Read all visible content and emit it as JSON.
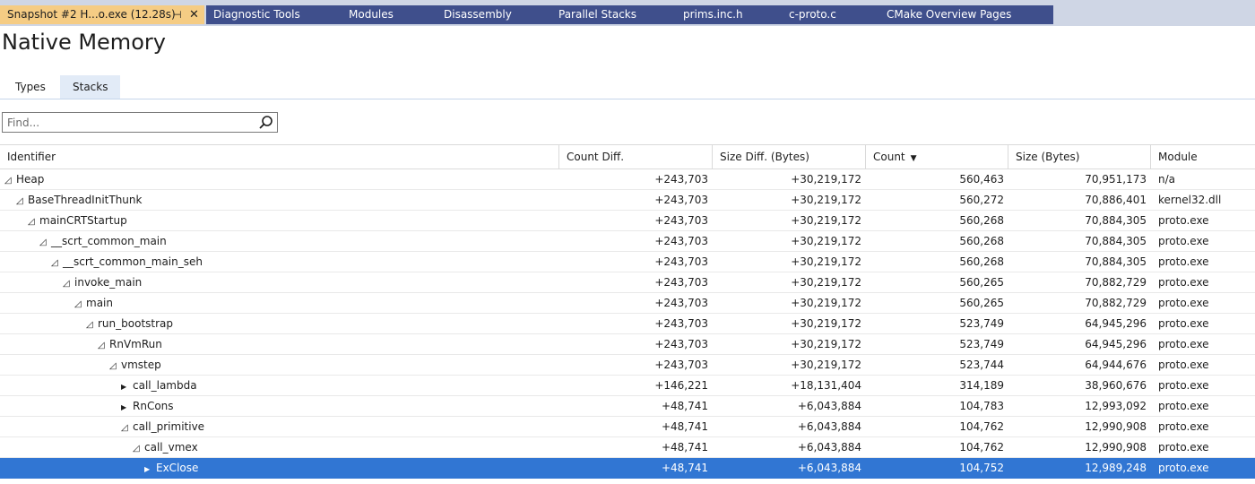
{
  "doc_tabs": [
    {
      "label": "Snapshot #2 H...o.exe (12.28s)",
      "active": true,
      "pin_icon": "pin-icon",
      "close_icon": "close-icon"
    },
    {
      "label": "Diagnostic Tools"
    },
    {
      "label": "Modules"
    },
    {
      "label": "Disassembly"
    },
    {
      "label": "Parallel Stacks"
    },
    {
      "label": "prims.inc.h"
    },
    {
      "label": "c-proto.c"
    },
    {
      "label": "CMake Overview Pages"
    }
  ],
  "page_title": "Native Memory",
  "view_tabs": [
    {
      "label": "Types",
      "selected": false
    },
    {
      "label": "Stacks",
      "selected": true
    }
  ],
  "search": {
    "placeholder": "Find...",
    "value": "",
    "icon": "search-icon"
  },
  "columns": {
    "identifier": "Identifier",
    "count_diff": "Count Diff.",
    "size_diff": "Size Diff. (Bytes)",
    "count": "Count",
    "size": "Size (Bytes)",
    "module": "Module",
    "sort_indicator": "▼"
  },
  "rows": [
    {
      "name": "Heap",
      "depth": 0,
      "expander": "expanded",
      "count_diff": "+243,703",
      "size_diff": "+30,219,172",
      "count": "560,463",
      "size": "70,951,173",
      "module": "n/a"
    },
    {
      "name": "BaseThreadInitThunk",
      "depth": 1,
      "expander": "expanded",
      "count_diff": "+243,703",
      "size_diff": "+30,219,172",
      "count": "560,272",
      "size": "70,886,401",
      "module": "kernel32.dll"
    },
    {
      "name": "mainCRTStartup",
      "depth": 2,
      "expander": "expanded",
      "count_diff": "+243,703",
      "size_diff": "+30,219,172",
      "count": "560,268",
      "size": "70,884,305",
      "module": "proto.exe"
    },
    {
      "name": "__scrt_common_main",
      "depth": 3,
      "expander": "expanded",
      "count_diff": "+243,703",
      "size_diff": "+30,219,172",
      "count": "560,268",
      "size": "70,884,305",
      "module": "proto.exe"
    },
    {
      "name": "__scrt_common_main_seh",
      "depth": 4,
      "expander": "expanded",
      "count_diff": "+243,703",
      "size_diff": "+30,219,172",
      "count": "560,268",
      "size": "70,884,305",
      "module": "proto.exe"
    },
    {
      "name": "invoke_main",
      "depth": 5,
      "expander": "expanded",
      "count_diff": "+243,703",
      "size_diff": "+30,219,172",
      "count": "560,265",
      "size": "70,882,729",
      "module": "proto.exe"
    },
    {
      "name": "main",
      "depth": 6,
      "expander": "expanded",
      "count_diff": "+243,703",
      "size_diff": "+30,219,172",
      "count": "560,265",
      "size": "70,882,729",
      "module": "proto.exe"
    },
    {
      "name": "run_bootstrap",
      "depth": 7,
      "expander": "expanded",
      "count_diff": "+243,703",
      "size_diff": "+30,219,172",
      "count": "523,749",
      "size": "64,945,296",
      "module": "proto.exe"
    },
    {
      "name": "RnVmRun",
      "depth": 8,
      "expander": "expanded",
      "count_diff": "+243,703",
      "size_diff": "+30,219,172",
      "count": "523,749",
      "size": "64,945,296",
      "module": "proto.exe"
    },
    {
      "name": "vmstep",
      "depth": 9,
      "expander": "expanded",
      "count_diff": "+243,703",
      "size_diff": "+30,219,172",
      "count": "523,744",
      "size": "64,944,676",
      "module": "proto.exe"
    },
    {
      "name": "call_lambda",
      "depth": 10,
      "expander": "collapsed",
      "count_diff": "+146,221",
      "size_diff": "+18,131,404",
      "count": "314,189",
      "size": "38,960,676",
      "module": "proto.exe"
    },
    {
      "name": "RnCons",
      "depth": 10,
      "expander": "collapsed",
      "count_diff": "+48,741",
      "size_diff": "+6,043,884",
      "count": "104,783",
      "size": "12,993,092",
      "module": "proto.exe"
    },
    {
      "name": "call_primitive",
      "depth": 10,
      "expander": "expanded",
      "count_diff": "+48,741",
      "size_diff": "+6,043,884",
      "count": "104,762",
      "size": "12,990,908",
      "module": "proto.exe"
    },
    {
      "name": "call_vmex",
      "depth": 11,
      "expander": "expanded",
      "count_diff": "+48,741",
      "size_diff": "+6,043,884",
      "count": "104,762",
      "size": "12,990,908",
      "module": "proto.exe"
    },
    {
      "name": "ExClose",
      "depth": 12,
      "expander": "collapsed",
      "count_diff": "+48,741",
      "size_diff": "+6,043,884",
      "count": "104,752",
      "size": "12,989,248",
      "module": "proto.exe",
      "selected": true
    }
  ]
}
